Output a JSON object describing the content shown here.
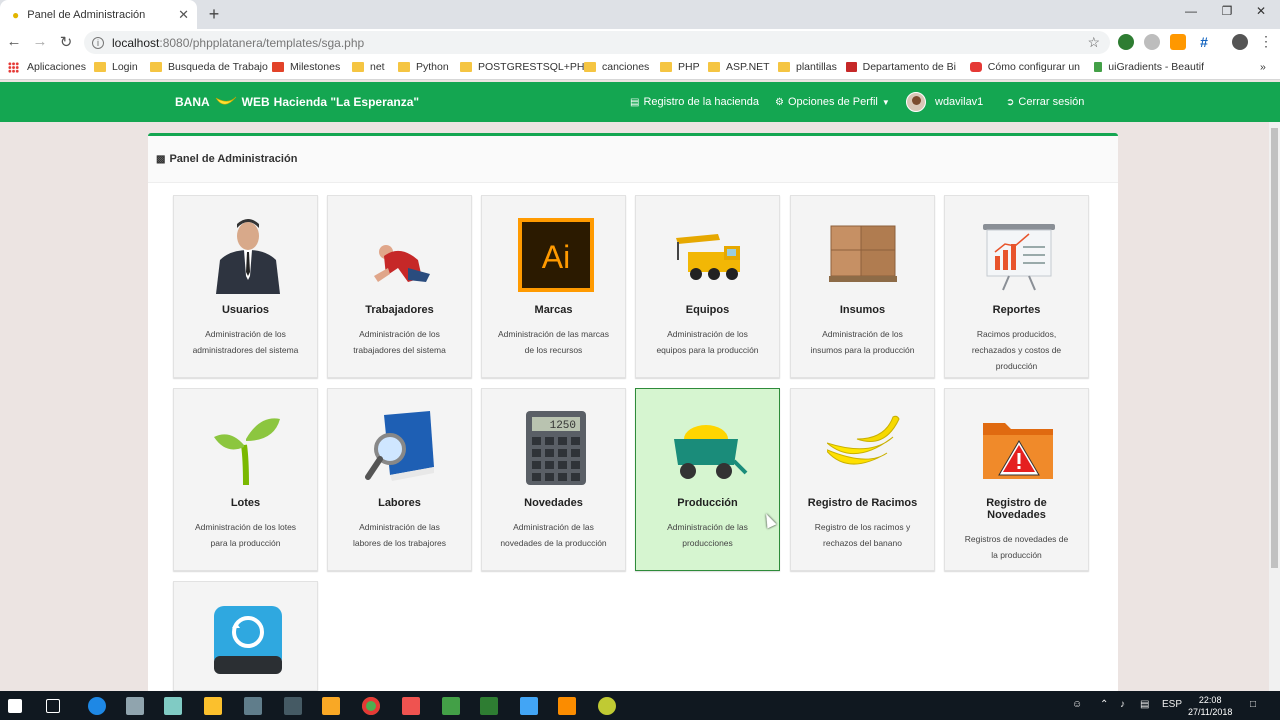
{
  "browser": {
    "tab_title": "Panel de Administración",
    "url_host": "localhost",
    "url_path": ":8080/phpplatanera/templates/sga.php",
    "bookmarks": [
      "Aplicaciones",
      "Login",
      "Busqueda de Trabajo",
      "Milestones",
      "net",
      "Python",
      "POSTGRESTSQL+PHP",
      "canciones",
      "PHP",
      "ASP.NET",
      "plantillas",
      "Departamento de Bi",
      "Cómo configurar un",
      "uiGradients - Beautif"
    ]
  },
  "nav": {
    "brand_left": "BANA",
    "brand_right": "WEB",
    "brand_sub": "Hacienda \"La Esperanza\"",
    "registro": "Registro de la hacienda",
    "opciones": "Opciones de Perfil",
    "user": "wdavilav1",
    "logout": "Cerrar sesión"
  },
  "panel": {
    "title": "Panel de Administración",
    "cards": [
      {
        "name": "Usuarios",
        "desc": "Administración de los administradores del sistema"
      },
      {
        "name": "Trabajadores",
        "desc": "Administración de los trabajadores del sistema"
      },
      {
        "name": "Marcas",
        "desc": "Administración de las marcas de los recursos"
      },
      {
        "name": "Equipos",
        "desc": "Administración de los equipos para la producción"
      },
      {
        "name": "Insumos",
        "desc": "Administración de los insumos para la producción"
      },
      {
        "name": "Reportes",
        "desc": "Racimos producidos, rechazados y costos de producción"
      },
      {
        "name": "Lotes",
        "desc": "Administración de los lotes para la producción"
      },
      {
        "name": "Labores",
        "desc": "Administración de las labores de los trabajores"
      },
      {
        "name": "Novedades",
        "desc": "Administración de las novedades de la producción"
      },
      {
        "name": "Producción",
        "desc": "Administración de las producciones"
      },
      {
        "name": "Registro de Racimos",
        "desc": "Registro de los racimos y rechazos del banano"
      },
      {
        "name": "Registro de Novedades",
        "desc": "Registros de novedades de la producción"
      }
    ]
  },
  "taskbar": {
    "lang": "ESP",
    "time": "22:08",
    "date": "27/11/2018"
  }
}
